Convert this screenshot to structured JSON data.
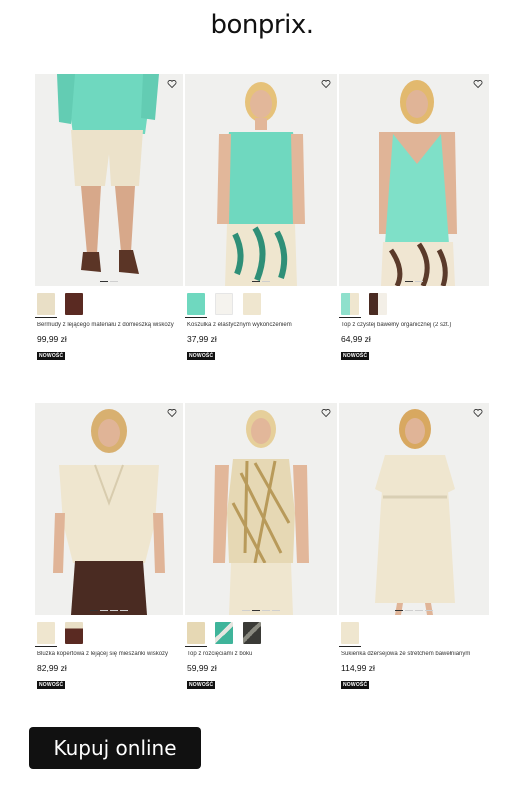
{
  "brand": {
    "logo": "bonprix."
  },
  "colors": {
    "mint": "#6fd8bf",
    "cream": "#efe6cf",
    "brown": "#4a2b22",
    "badge": "#111111"
  },
  "icons": {
    "wishlist": "heart-icon"
  },
  "products": [
    {
      "name": "Bermudy z lejącego materiału z domieszką wiskozy",
      "price": "99,99 zł",
      "badge": "NOWOŚĆ",
      "swatch_colors": [
        "#e9dfc6",
        "#5a2a22"
      ],
      "selected": 0,
      "image_dots": 2,
      "active_dot": 0
    },
    {
      "name": "Koszulka z elastycznym wykończeniem",
      "price": "37,99 zł",
      "badge": "NOWOŚĆ",
      "swatch_colors": [
        "#6fd8bf",
        "#f5f3ee",
        "#efe6cf"
      ],
      "selected": 0,
      "image_dots": 2,
      "active_dot": 0
    },
    {
      "name": "Top z czystej bawełny organicznej (2 szt.)",
      "price": "64,99 zł",
      "badge": "NOWOŚĆ",
      "swatch_colors": [
        "#8fe0cc",
        "#4a2b22"
      ],
      "selected": 0,
      "image_dots": 2,
      "active_dot": 0
    },
    {
      "name": "Bluzka kopertowa z lejącej się mieszanki wiskozy",
      "price": "82,99 zł",
      "badge": "NOWOŚĆ",
      "swatch_colors": [
        "#efe6cf",
        "#5a2a22"
      ],
      "selected": 0,
      "image_dots": 4,
      "active_dot": 0
    },
    {
      "name": "Top z rozcięciami z boku",
      "price": "59,99 zł",
      "badge": "NOWOŚĆ",
      "swatch_colors": [
        "#e6d8b4",
        "#3fb49a",
        "#3a3a36"
      ],
      "selected": 0,
      "image_dots": 4,
      "active_dot": 1
    },
    {
      "name": "Sukienka dżersejowa ze stretchem bawełnianym",
      "price": "114,99 zł",
      "badge": "NOWOŚĆ",
      "swatch_colors": [
        "#efe6cf"
      ],
      "selected": 0,
      "image_dots": 4,
      "active_dot": 0
    }
  ],
  "cta": {
    "label": "Kupuj online"
  }
}
